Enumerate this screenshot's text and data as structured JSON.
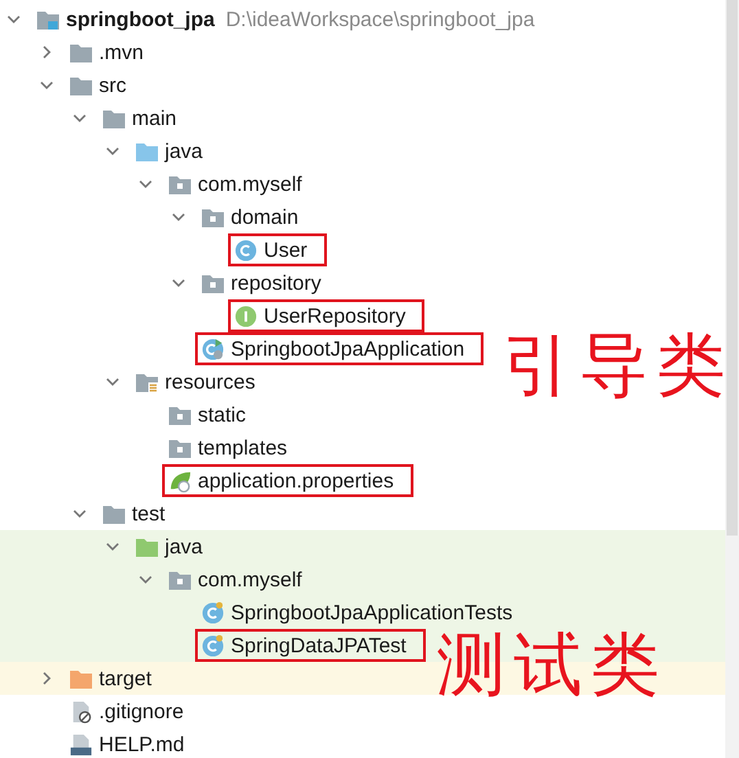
{
  "tree": [
    {
      "label": "springboot_jpa",
      "path": "D:\\ideaWorkspace\\springboot_jpa",
      "kind": "project",
      "expanded": true,
      "marked": false,
      "children": [
        {
          "label": ".mvn",
          "kind": "folder",
          "expanded": false,
          "marked": false
        },
        {
          "label": "src",
          "kind": "folder",
          "expanded": true,
          "marked": false,
          "children": [
            {
              "label": "main",
              "kind": "folder",
              "expanded": true,
              "marked": false,
              "children": [
                {
                  "label": "java",
                  "kind": "source-folder",
                  "expanded": true,
                  "marked": false,
                  "children": [
                    {
                      "label": "com.myself",
                      "kind": "package",
                      "expanded": true,
                      "marked": false,
                      "children": [
                        {
                          "label": "domain",
                          "kind": "package",
                          "expanded": true,
                          "marked": false,
                          "children": [
                            {
                              "label": "User",
                              "kind": "class",
                              "marked": true
                            }
                          ]
                        },
                        {
                          "label": "repository",
                          "kind": "package",
                          "expanded": true,
                          "marked": false,
                          "children": [
                            {
                              "label": "UserRepository",
                              "kind": "interface",
                              "marked": true
                            }
                          ]
                        },
                        {
                          "label": "SpringbootJpaApplication",
                          "kind": "boot-class",
                          "marked": true
                        }
                      ]
                    }
                  ]
                },
                {
                  "label": "resources",
                  "kind": "resources-folder",
                  "expanded": true,
                  "marked": false,
                  "children": [
                    {
                      "label": "static",
                      "kind": "package",
                      "marked": false
                    },
                    {
                      "label": "templates",
                      "kind": "package",
                      "marked": false
                    },
                    {
                      "label": "application.properties",
                      "kind": "properties",
                      "marked": true
                    }
                  ]
                }
              ]
            },
            {
              "label": "test",
              "kind": "folder",
              "expanded": true,
              "marked": false,
              "children": [
                {
                  "label": "java",
                  "kind": "test-folder",
                  "expanded": true,
                  "marked": false,
                  "color": "#eef6e6",
                  "children": [
                    {
                      "label": "com.myself",
                      "kind": "package",
                      "expanded": true,
                      "marked": false,
                      "color": "#eef6e6",
                      "children": [
                        {
                          "label": "SpringbootJpaApplicationTests",
                          "kind": "test-class",
                          "marked": false,
                          "color": "#eef6e6"
                        },
                        {
                          "label": "SpringDataJPATest",
                          "kind": "test-class",
                          "marked": true,
                          "color": "#eef6e6"
                        }
                      ]
                    }
                  ]
                }
              ]
            }
          ]
        },
        {
          "label": "target",
          "kind": "excluded-folder",
          "expanded": false,
          "marked": false,
          "color": "#fdf8e3"
        },
        {
          "label": ".gitignore",
          "kind": "ignore-file",
          "marked": false
        },
        {
          "label": "HELP.md",
          "kind": "md-file",
          "marked": false
        }
      ]
    }
  ],
  "annotations": [
    {
      "text": "引导类"
    },
    {
      "text": "测试类"
    }
  ]
}
